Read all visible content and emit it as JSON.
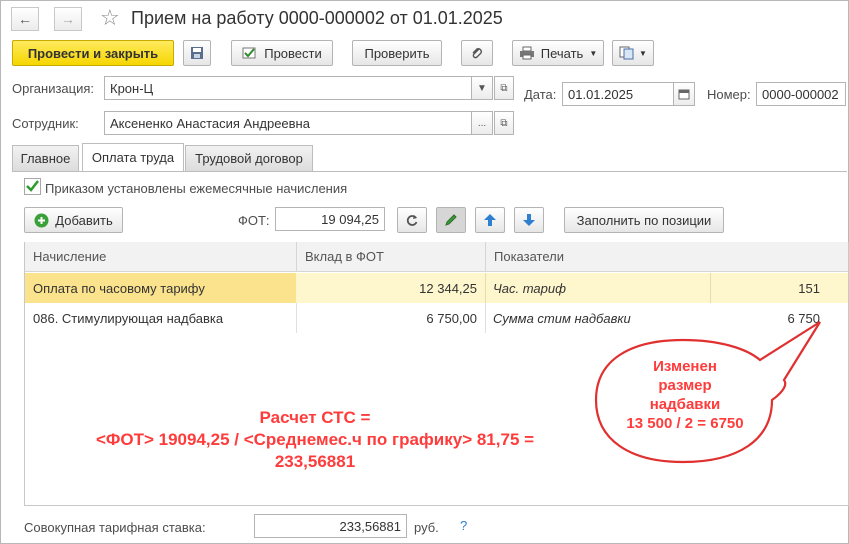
{
  "window": {
    "title": "Прием на работу 0000-000002 от 01.01.2025"
  },
  "toolbar": {
    "post_close": "Провести и закрыть",
    "post": "Провести",
    "check": "Проверить",
    "print": "Печать"
  },
  "form": {
    "org_label": "Организация:",
    "org_value": "Крон-Ц",
    "date_label": "Дата:",
    "date_value": "01.01.2025",
    "number_label": "Номер:",
    "number_value": "0000-000002",
    "employee_label": "Сотрудник:",
    "employee_value": "Аксененко Анастасия Андреевна"
  },
  "tabs": [
    {
      "label": "Главное"
    },
    {
      "label": "Оплата труда"
    },
    {
      "label": "Трудовой договор"
    }
  ],
  "pay": {
    "checkbox_label": "Приказом установлены ежемесячные начисления",
    "checkbox_checked": true,
    "add_label": "Добавить",
    "fot_label": "ФОТ:",
    "fot_value": "19 094,25",
    "fill_label": "Заполнить по позиции"
  },
  "table": {
    "headers": [
      "Начисление",
      "Вклад в ФОТ",
      "Показатели"
    ],
    "rows": [
      {
        "name": "Оплата по часовому тарифу",
        "fot": "12 344,25",
        "indicator": "Час. тариф",
        "value": "151"
      },
      {
        "name": "086. Стимулирующая надбавка",
        "fot": "6 750,00",
        "indicator": "Сумма стим надбавки",
        "value": "6 750"
      }
    ]
  },
  "annotations": {
    "calc_line1": "Расчет СТС =",
    "calc_line2": "<ФОТ> 19094,25 / <Среднемес.ч по графику> 81,75 =",
    "calc_line3": "233,56881",
    "bubble_line1": "Изменен",
    "bubble_line2": "размер",
    "bubble_line3": "надбавки",
    "bubble_line4": "13 500 / 2 = 6750"
  },
  "footer": {
    "rate_label": "Совокупная тарифная ставка:",
    "rate_value": "233,56881",
    "currency": "руб.",
    "help": "?"
  },
  "colors": {
    "accent_yellow": "#f6d600",
    "annotation_red": "#ff3c3c",
    "selected_row": "#fef6cd"
  }
}
